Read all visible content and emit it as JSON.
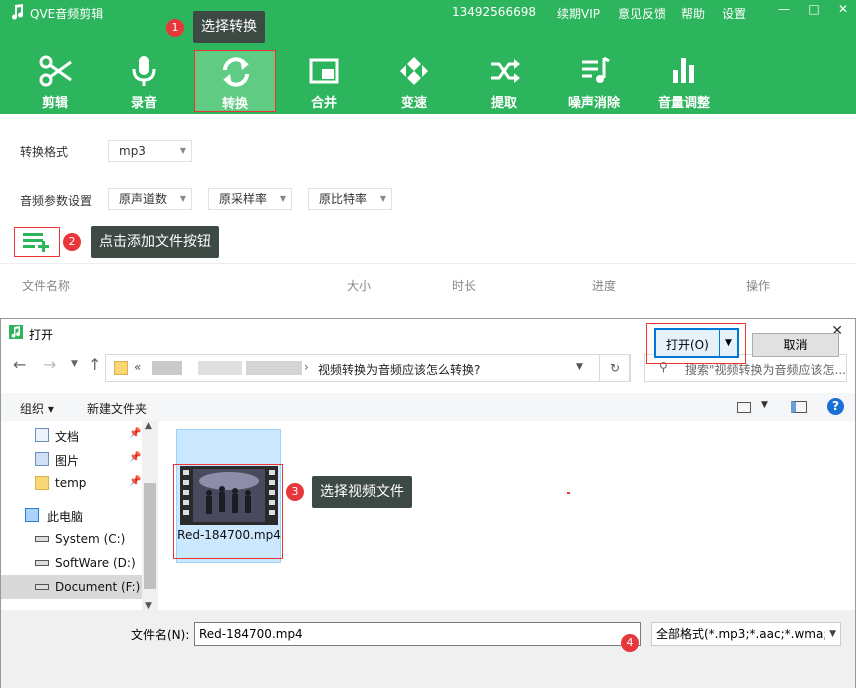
{
  "app": {
    "title": "QVE音频剪辑",
    "phone": "13492566698",
    "renew_vip": "续期VIP",
    "feedback": "意见反馈",
    "help": "帮助",
    "settings": "设置",
    "window_controls": [
      "—",
      "□",
      "✕"
    ]
  },
  "toolbar": {
    "items": [
      {
        "label": "剪辑",
        "icon": "scissors-icon"
      },
      {
        "label": "录音",
        "icon": "microphone-icon"
      },
      {
        "label": "转换",
        "icon": "convert-icon",
        "active": true
      },
      {
        "label": "合并",
        "icon": "merge-icon"
      },
      {
        "label": "变速",
        "icon": "speed-icon"
      },
      {
        "label": "提取",
        "icon": "extract-icon"
      },
      {
        "label": "噪声消除",
        "icon": "noise-removal-icon"
      },
      {
        "label": "音量调整",
        "icon": "volume-bars-icon"
      }
    ]
  },
  "tooltips": {
    "step1": {
      "num": "1",
      "text": "选择转换"
    },
    "step2": {
      "num": "2",
      "text": "点击添加文件按钮"
    },
    "step3": {
      "num": "3",
      "text": "选择视频文件"
    },
    "step4": {
      "num": "4"
    }
  },
  "convert": {
    "format_label": "转换格式",
    "format_value": "mp3",
    "params_label": "音频参数设置",
    "channels": "原声道数",
    "sample_rate": "原采样率",
    "bitrate": "原比特率"
  },
  "file_table": {
    "columns": [
      "文件名称",
      "大小",
      "时长",
      "进度",
      "操作"
    ]
  },
  "dialog": {
    "title": "打开",
    "close": "✕",
    "path_prefix": "«",
    "path_current": "视频转换为音频应该怎么转换?",
    "search_placeholder": "搜索\"视频转换为音频应该怎...",
    "organize": "组织",
    "new_folder": "新建文件夹",
    "tree": [
      {
        "label": "文档",
        "pinned": true,
        "icon": "documents-icon"
      },
      {
        "label": "图片",
        "pinned": true,
        "icon": "pictures-icon"
      },
      {
        "label": "temp",
        "pinned": true,
        "icon": "folder-icon"
      },
      {
        "label": "此电脑",
        "icon": "computer-icon"
      },
      {
        "label": "System (C:)",
        "icon": "drive-icon"
      },
      {
        "label": "SoftWare (D:)",
        "icon": "drive-icon"
      },
      {
        "label": "Document (F:)",
        "icon": "drive-icon",
        "selected": true
      }
    ],
    "file": {
      "name": "Red-184700.mp4"
    },
    "filename_label": "文件名(N):",
    "filename_value": "Red-184700.mp4",
    "filetype_value": "全部格式(*.mp3;*.aac;*.wma;*",
    "open_button": "打开(O)",
    "cancel_button": "取消"
  },
  "colors": {
    "brand_green": "#2db55d",
    "highlight_red": "#e33",
    "tooltip_bg": "#3d4a44"
  }
}
